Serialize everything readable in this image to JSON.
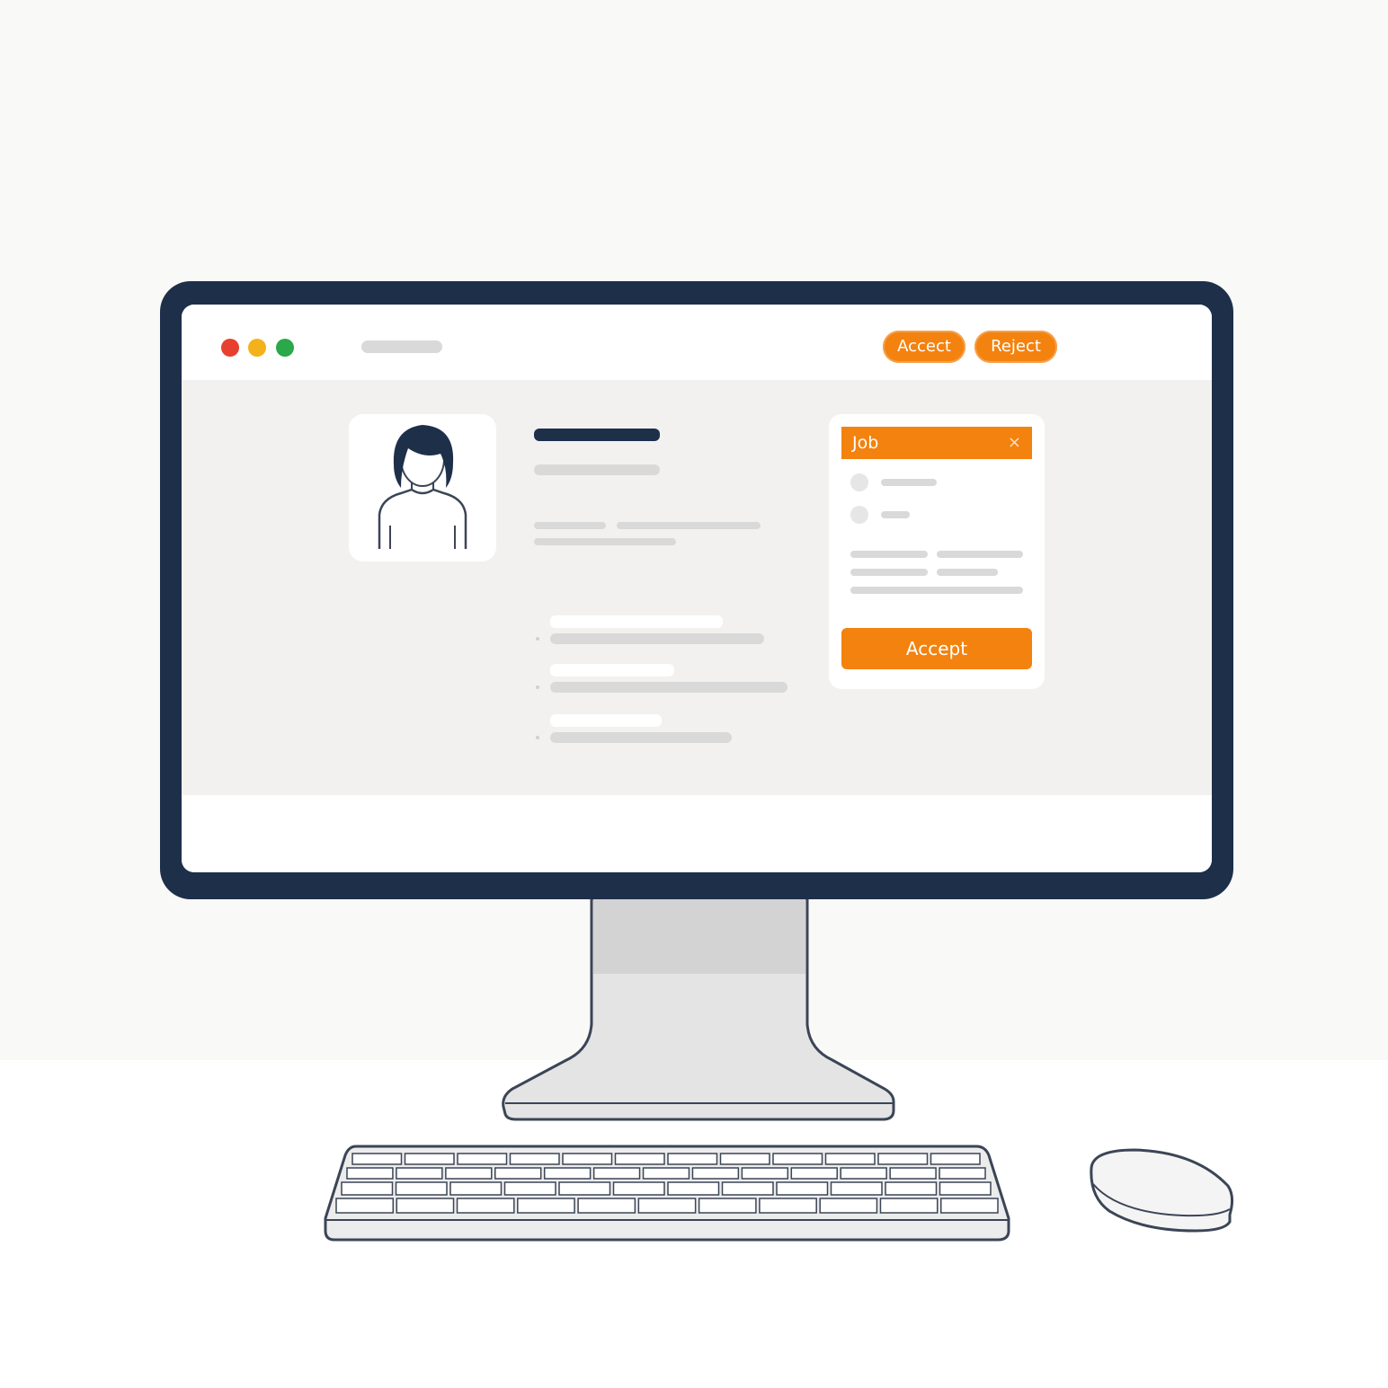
{
  "browser": {
    "window_controls": [
      "close-dot",
      "minimize-dot",
      "maximize-dot"
    ],
    "toolbar": {
      "accept_label": "Accect",
      "reject_label": "Reject"
    }
  },
  "job_card": {
    "title": "Job",
    "close_glyph": "×",
    "accept_label": "Accept"
  },
  "colors": {
    "accent": "#f3820f",
    "bezel": "#1e2f4a",
    "content_bg": "#f3f1ef",
    "placeholder": "#d9d9d9"
  },
  "icons": {
    "profile": "person-avatar-icon",
    "close": "close-icon"
  }
}
